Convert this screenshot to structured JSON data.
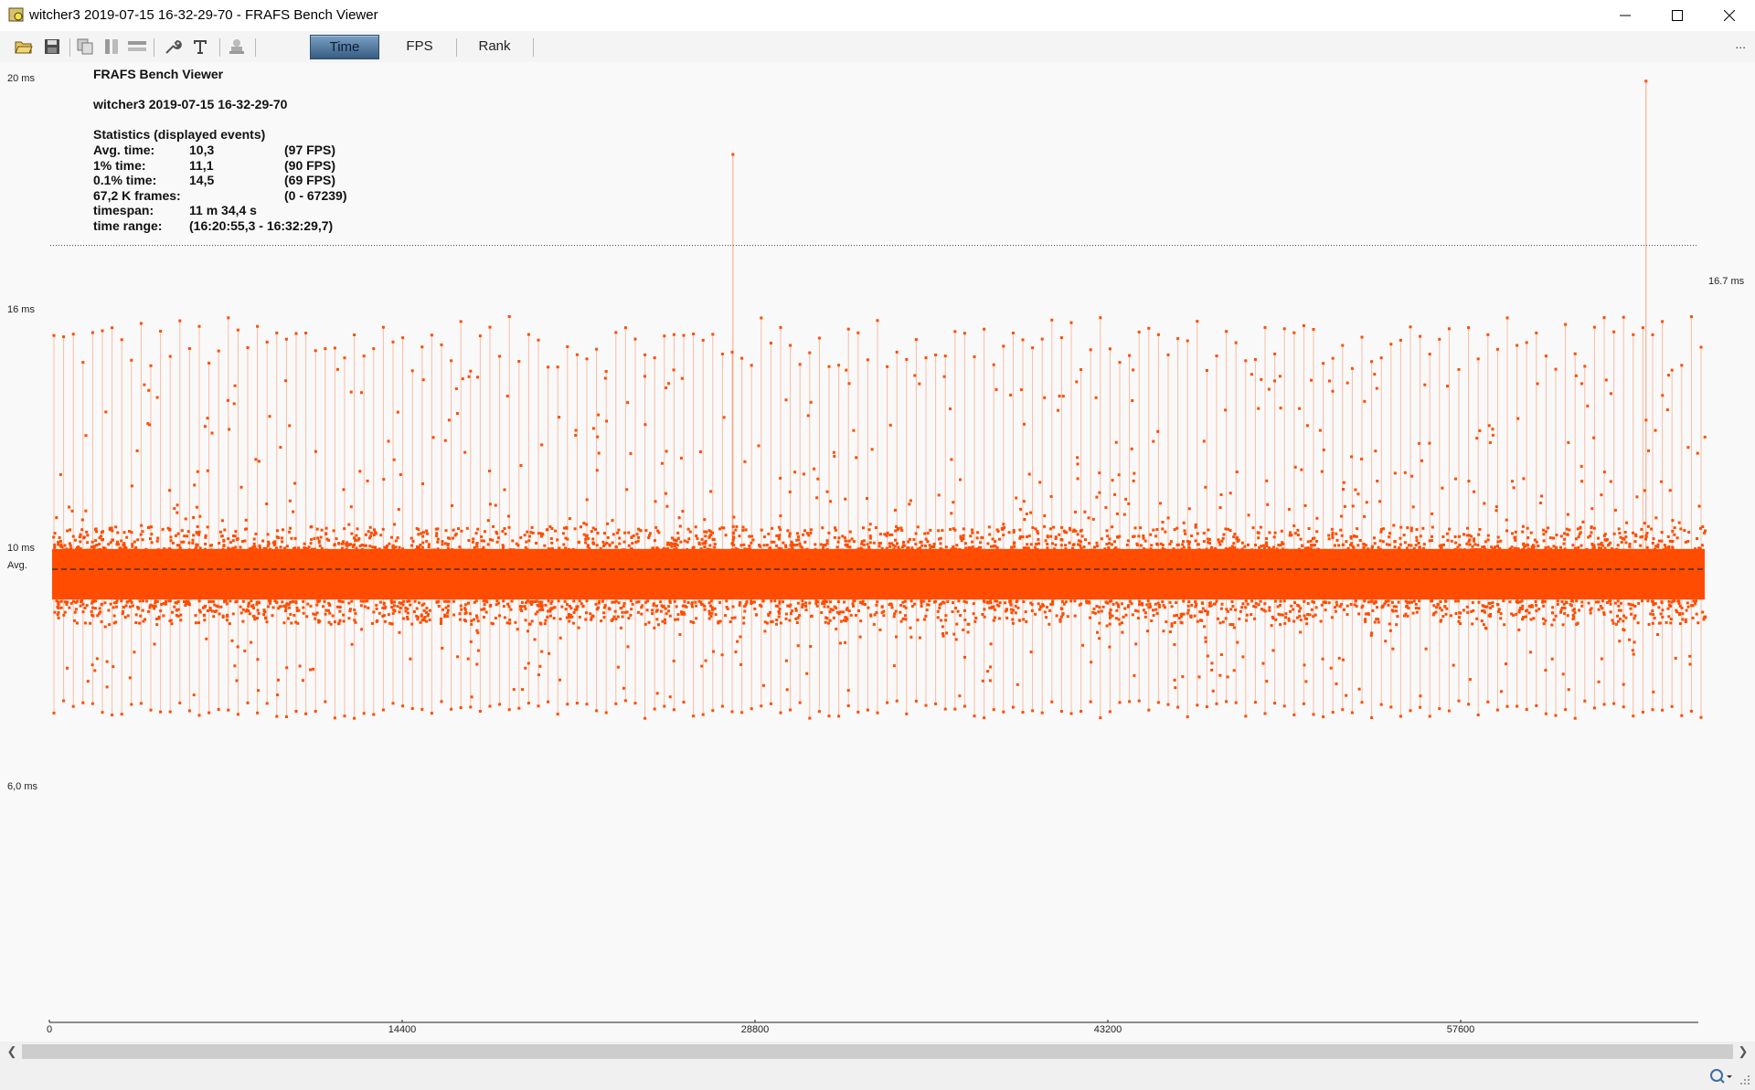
{
  "window": {
    "title": "witcher3 2019-07-15 16-32-29-70 - FRAFS Bench Viewer",
    "icons": [
      "app-icon",
      "minimize-icon",
      "maximize-icon",
      "close-icon"
    ]
  },
  "toolbar": {
    "icons": [
      "open-folder-icon",
      "save-icon",
      "copy-icon",
      "vertical-split-icon",
      "horizontal-split-icon",
      "wrench-icon",
      "text-icon",
      "stamp-icon"
    ],
    "tabs": [
      "Time",
      "FPS",
      "Rank"
    ],
    "active_tab": "Time",
    "overflow_label": "..."
  },
  "stats": {
    "app_name": "FRAFS Bench Viewer",
    "file_name": "witcher3 2019-07-15 16-32-29-70",
    "header": "Statistics (displayed events)",
    "rows": [
      {
        "label": "Avg. time:",
        "value": "10,3",
        "extra": "(97 FPS)"
      },
      {
        "label": "1% time:",
        "value": "11,1",
        "extra": "(90 FPS)"
      },
      {
        "label": "0.1% time:",
        "value": "14,5",
        "extra": "(69 FPS)"
      },
      {
        "label": "67,2 K frames:",
        "value": "",
        "extra": "(0 - 67239)"
      },
      {
        "label": "timespan:",
        "value": "11 m 34,4 s",
        "extra": ""
      },
      {
        "label": "time range:",
        "value": "(16:20:55,3 - 16:32:29,7)",
        "extra": ""
      }
    ]
  },
  "chart_data": {
    "type": "scatter",
    "title": "",
    "xlabel": "",
    "ylabel": "",
    "x_ticks": [
      "0",
      "14400",
      "28800",
      "43200",
      "57600"
    ],
    "y_ticks": [
      "20 ms",
      "16 ms",
      "10 ms",
      "6,0 ms"
    ],
    "avg_label": "Avg.",
    "xlim": [
      0,
      67239
    ],
    "ylim": [
      6,
      20
    ],
    "avg_value": 10.3,
    "reference_line": {
      "value": 16.7,
      "label": "16.7 ms"
    },
    "marker_color": "#ff4c00",
    "band": {
      "center": 10.2,
      "core_low": 9.7,
      "core_high": 10.7
    },
    "spikes": [
      {
        "x": 27700,
        "y": 18.5
      },
      {
        "x": 64850,
        "y": 19.95
      }
    ],
    "outer_range": [
      7.3,
      15.3
    ]
  },
  "status": {
    "icons": [
      "zoom-icon",
      "resize-grip-icon"
    ]
  }
}
